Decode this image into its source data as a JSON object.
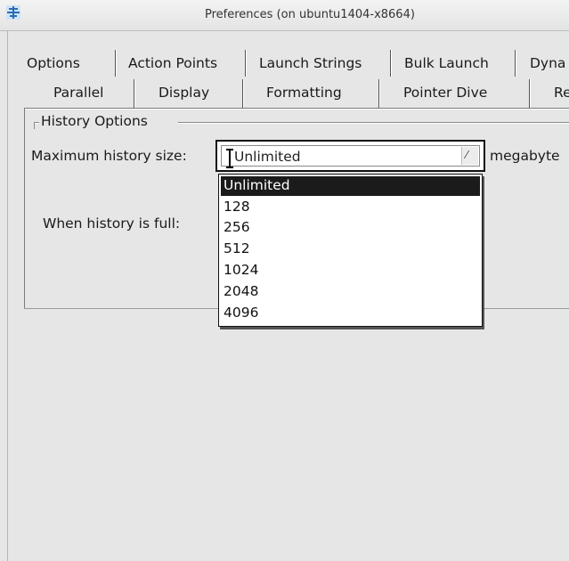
{
  "window": {
    "title": "Preferences (on ubuntu1404-x8664)"
  },
  "tabs": {
    "row1": [
      "Options",
      "Action Points",
      "Launch Strings",
      "Bulk Launch",
      "Dyna"
    ],
    "row2": [
      "Parallel",
      "Display",
      "Formatting",
      "Pointer Dive",
      "Re"
    ]
  },
  "history": {
    "group_label": "History Options",
    "max_size_label": "Maximum history size:",
    "max_size_value": "Unlimited",
    "units_label": "megabyte",
    "when_full_label": "When history is full:",
    "options": [
      "Unlimited",
      "128",
      "256",
      "512",
      "1024",
      "2048",
      "4096"
    ],
    "selected_index": 0
  },
  "icons": {
    "app": "app-icon",
    "dropdown": "chevron-down-icon"
  }
}
